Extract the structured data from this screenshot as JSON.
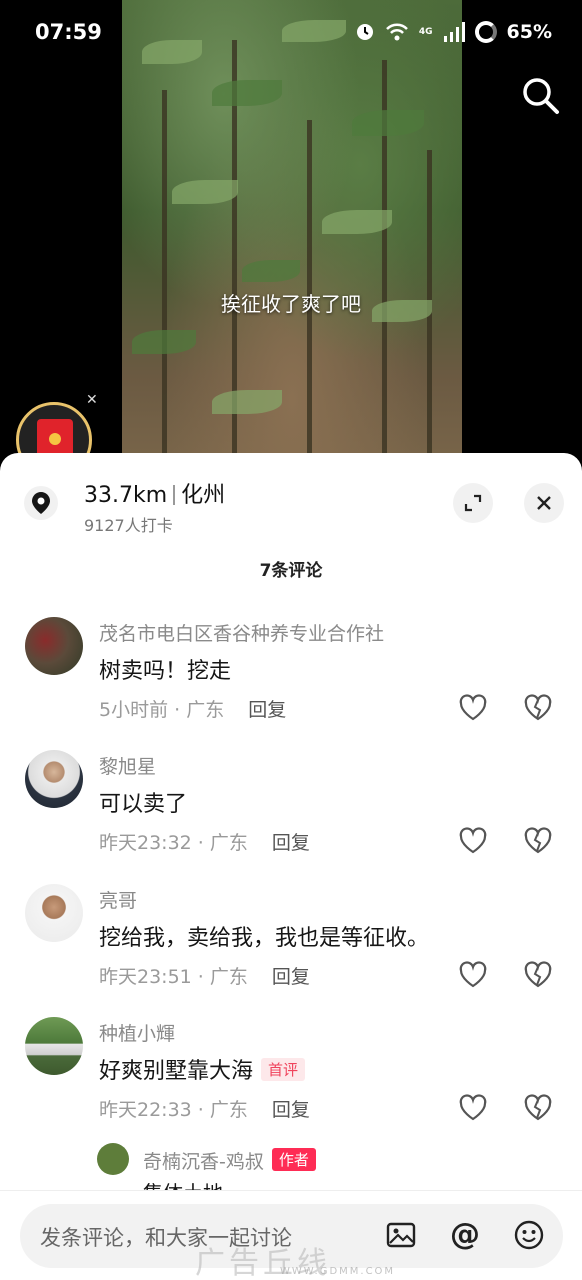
{
  "status_bar": {
    "time": "07:59",
    "network": "4G",
    "battery": "65%"
  },
  "video": {
    "caption": "挨征收了爽了吧"
  },
  "location": {
    "distance": "33.7km",
    "city": "化州",
    "checkins": "9127人打卡"
  },
  "comments_header": {
    "count": "7条评论"
  },
  "comments": [
    {
      "user": "茂名市电白区香谷种养专业合作社",
      "text": "树卖吗！挖走",
      "time": "5小时前 · 广东",
      "reply": "回复",
      "badge": ""
    },
    {
      "user": "黎旭星",
      "text": "可以卖了",
      "time": "昨天23:32 · 广东",
      "reply": "回复",
      "badge": ""
    },
    {
      "user": "亮哥",
      "text": "挖给我，卖给我，我也是等征收。",
      "time": "昨天23:51 · 广东",
      "reply": "回复",
      "badge": ""
    },
    {
      "user": "种植小輝",
      "text": "好爽别墅靠大海",
      "time": "昨天22:33 · 广东",
      "reply": "回复",
      "badge": "首评"
    }
  ],
  "sub_comment": {
    "user": "奇楠沉香-鸡叔",
    "badge": "作者",
    "text": "集体土地"
  },
  "input": {
    "placeholder": "发条评论，和大家一起讨论"
  },
  "watermark": {
    "main": "广告丘线",
    "sub": "WWW.GDMM.COM"
  },
  "colors": {
    "accent": "#fe2c55",
    "first_badge": "#f0425b"
  }
}
